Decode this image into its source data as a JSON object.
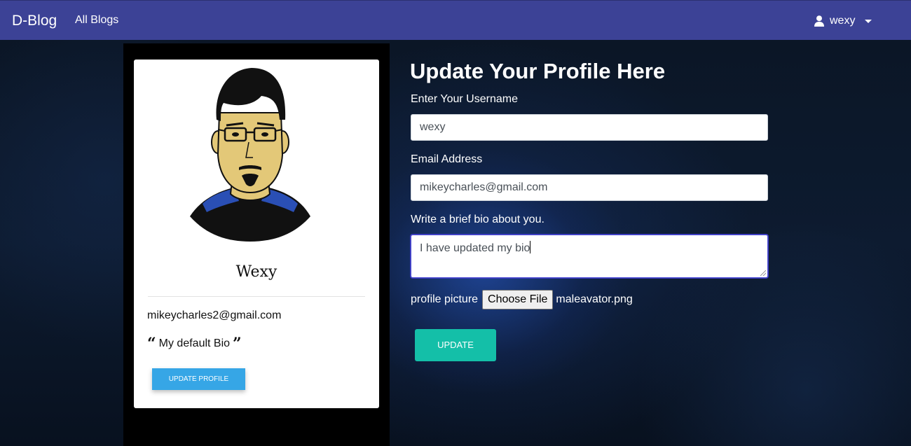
{
  "navbar": {
    "brand": "D-Blog",
    "links": [
      {
        "label": "All Blogs"
      }
    ],
    "user": {
      "name": "wexy",
      "icon": "user-icon"
    }
  },
  "profile_card": {
    "name": "Wexy",
    "email": "mikeycharles2@gmail.com",
    "bio": "My default Bio",
    "button_label": "UPDATE PROFILE"
  },
  "form": {
    "title": "Update Your Profile Here",
    "username": {
      "label": "Enter Your Username",
      "value": "wexy"
    },
    "email": {
      "label": "Email Address",
      "value": "mikeycharles@gmail.com"
    },
    "bio": {
      "label": "Write a brief bio about you.",
      "value": "I have updated my bio"
    },
    "picture": {
      "label": "profile picture",
      "button_label": "Choose File",
      "file_name": "maleavator.png"
    },
    "submit_label": "UPDATE"
  },
  "colors": {
    "navbar": "#3c4296",
    "update_button": "#14bfa8",
    "profile_button": "#36a6e6"
  }
}
